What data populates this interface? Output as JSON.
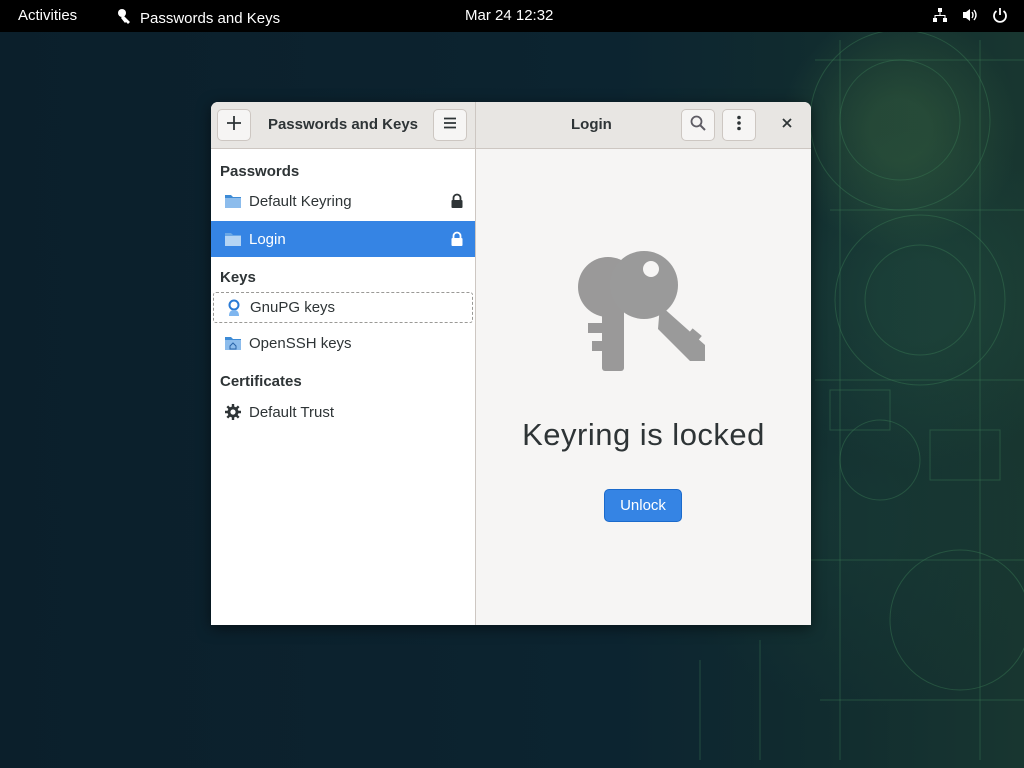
{
  "topbar": {
    "activities": "Activities",
    "app_name": "Passwords and Keys",
    "clock": "Mar 24  12:32",
    "tray_icons": [
      "network-icon",
      "volume-icon",
      "power-icon"
    ]
  },
  "window": {
    "sidebar_title": "Passwords and Keys",
    "content_title": "Login",
    "header_icons": [
      "add-icon",
      "hamburger-menu-icon",
      "search-icon",
      "more-vertical-icon",
      "close-icon"
    ]
  },
  "sidebar": {
    "passwords_heading": "Passwords",
    "passwords": [
      {
        "label": "Default Keyring",
        "icon": "folder-icon",
        "locked": true
      },
      {
        "label": "Login",
        "icon": "folder-icon",
        "locked": true,
        "selected": true
      }
    ],
    "keys_heading": "Keys",
    "keys": [
      {
        "label": "GnuPG keys",
        "icon": "gnupg-icon"
      },
      {
        "label": "OpenSSH keys",
        "icon": "folder-home-icon"
      }
    ],
    "certificates_heading": "Certificates",
    "certificates": [
      {
        "label": "Default Trust",
        "icon": "gear-icon"
      }
    ]
  },
  "content": {
    "icon": "keys-icon",
    "message": "Keyring is locked",
    "unlock_label": "Unlock"
  },
  "colors": {
    "accent": "#3584e4",
    "topbar": "#000000",
    "window_bg": "#f6f5f4"
  }
}
